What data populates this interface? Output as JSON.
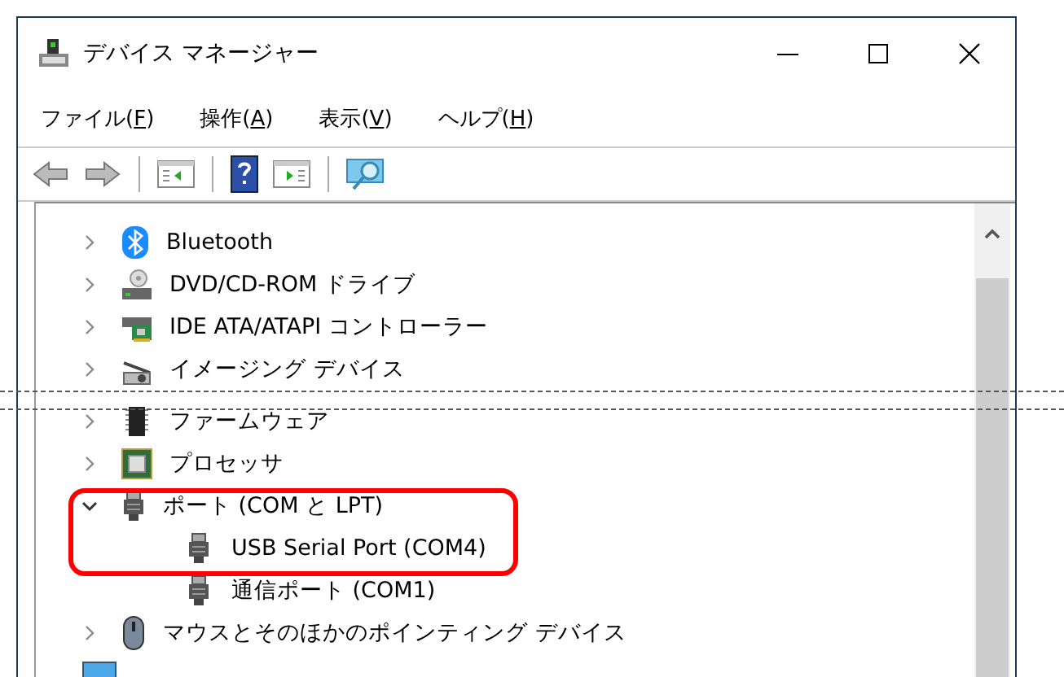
{
  "window": {
    "title": "デバイス マネージャー"
  },
  "menu": [
    {
      "label": "ファイル(F)"
    },
    {
      "label": "操作(A)"
    },
    {
      "label": "表示(V)"
    },
    {
      "label": "ヘルプ(H)"
    }
  ],
  "tree": [
    {
      "kind": "device",
      "label": "Bluetooth",
      "expanded": false
    },
    {
      "kind": "device",
      "label": "DVD/CD-ROM ドライブ",
      "expanded": false
    },
    {
      "kind": "device",
      "label": "IDE ATA/ATAPI コントローラー",
      "expanded": false
    },
    {
      "kind": "device",
      "label": "イメージング デバイス",
      "expanded": false
    },
    {
      "kind": "break"
    },
    {
      "kind": "device",
      "label": "ファームウェア",
      "expanded": false
    },
    {
      "kind": "device",
      "label": "プロセッサ",
      "expanded": false
    },
    {
      "kind": "device",
      "label": "ポート (COM と LPT)",
      "expanded": true,
      "highlighted": true,
      "children": [
        {
          "label": "USB Serial Port (COM4)",
          "highlighted": true
        },
        {
          "label": "通信ポート (COM1)"
        }
      ]
    },
    {
      "kind": "device",
      "label": "マウスとそのほかのポインティング デバイス",
      "expanded": false
    },
    {
      "kind": "device"
    }
  ]
}
